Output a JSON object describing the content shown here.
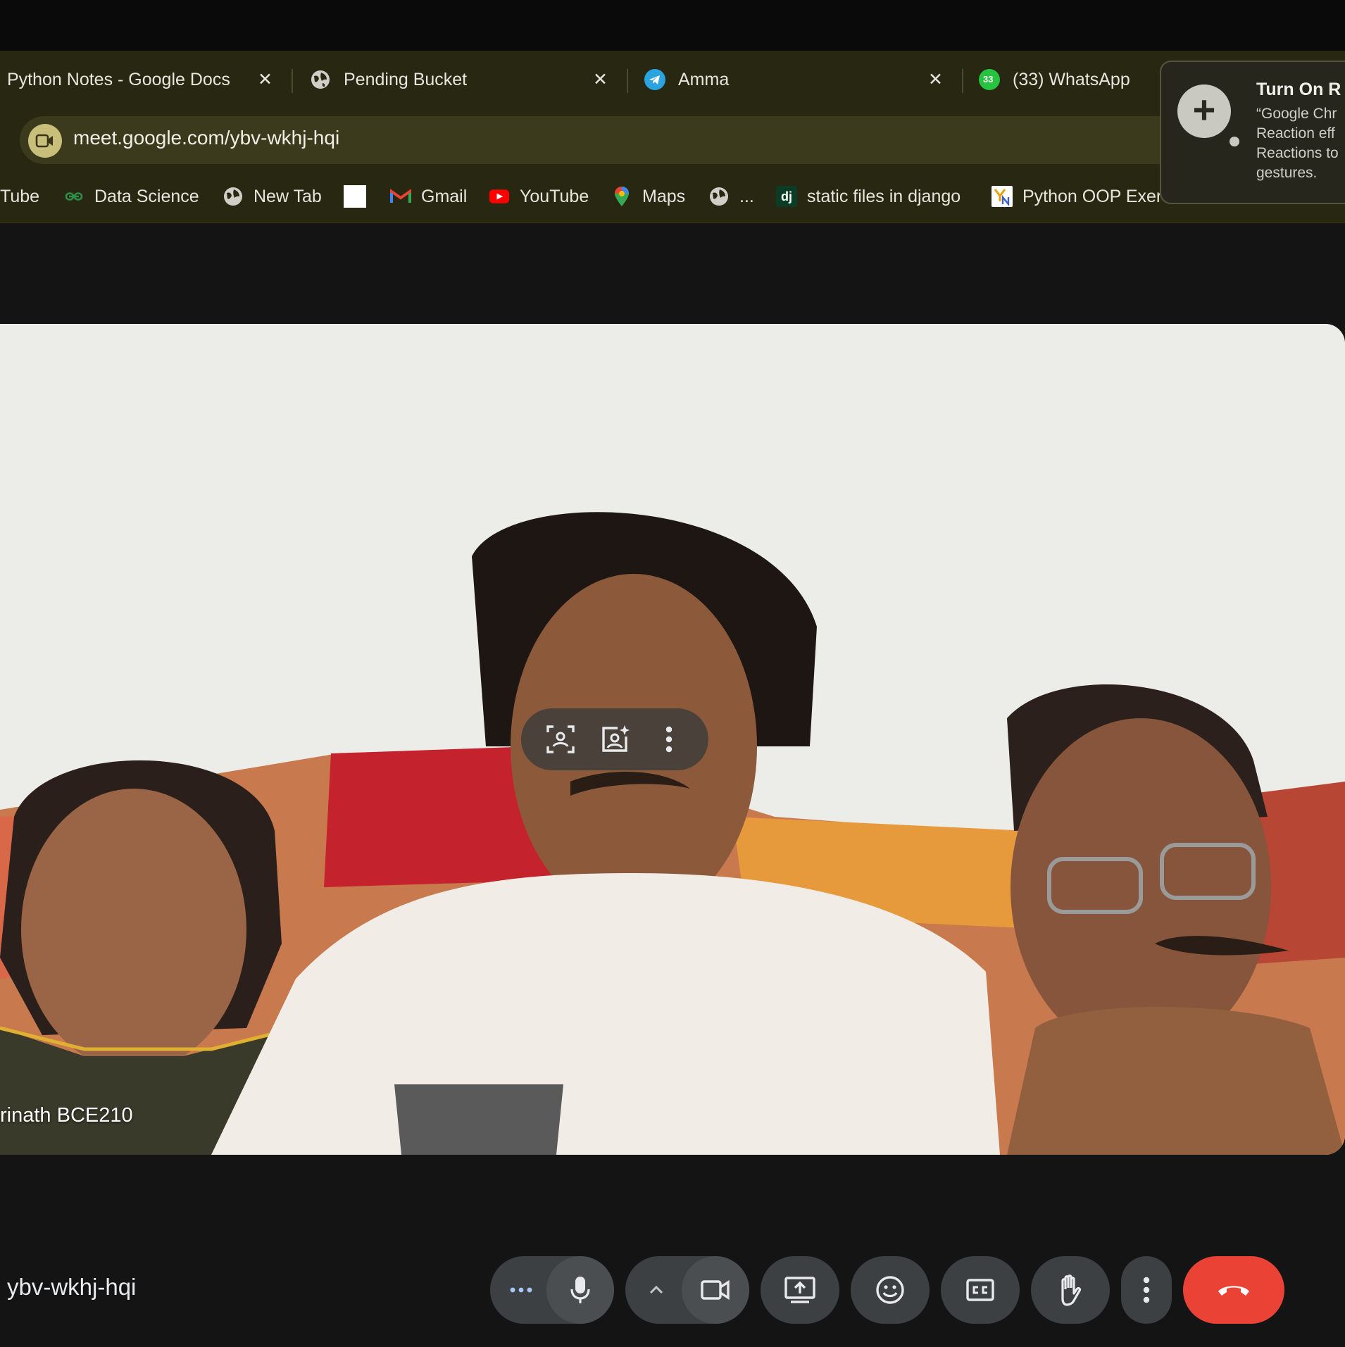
{
  "browser": {
    "tabs": [
      {
        "label": "Python Notes - Google Docs"
      },
      {
        "label": "Pending Bucket"
      },
      {
        "label": "Amma"
      },
      {
        "label": "(33) WhatsApp",
        "badge": "33"
      }
    ],
    "url": "meet.google.com/ybv-wkhj-hqi",
    "bookmarks": [
      {
        "label": "Tube"
      },
      {
        "label": "Data Science"
      },
      {
        "label": "New Tab"
      },
      {
        "label": ""
      },
      {
        "label": "Gmail"
      },
      {
        "label": "YouTube"
      },
      {
        "label": "Maps"
      },
      {
        "label": "..."
      },
      {
        "label": "static files in django",
        "icon_text": "dj"
      },
      {
        "label": "Python OOP Exerc"
      }
    ]
  },
  "notification": {
    "title": "Turn On R",
    "body": "“Google Chr\nReaction eff\nReactions to\ngestures."
  },
  "meet": {
    "participant_name": "rinath BCE210",
    "meeting_code": "ybv-wkhj-hqi",
    "controls": [
      "more-options",
      "microphone",
      "camera-options",
      "camera",
      "present-screen",
      "reactions",
      "captions",
      "raise-hand",
      "more-actions",
      "leave-call"
    ]
  },
  "colors": {
    "chrome_bar": "#282711",
    "meet_background": "#141414",
    "control_button": "#3c4043",
    "hangup": "#ea4335"
  }
}
